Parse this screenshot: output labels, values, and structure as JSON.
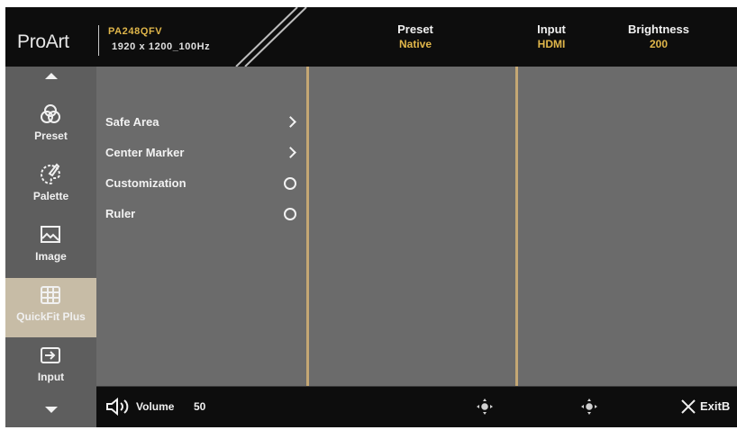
{
  "header": {
    "brand": "ProArt",
    "model": "PA248QFV",
    "resolution": "1920 x 1200_100Hz",
    "status": [
      {
        "label": "Preset",
        "value": "Native"
      },
      {
        "label": "Input",
        "value": "HDMI"
      },
      {
        "label": "Brightness",
        "value": "200"
      }
    ]
  },
  "sidebar": {
    "items": [
      {
        "label": "Preset",
        "icon": "preset-icon"
      },
      {
        "label": "Palette",
        "icon": "palette-icon"
      },
      {
        "label": "Image",
        "icon": "image-icon"
      },
      {
        "label": "QuickFit Plus",
        "icon": "grid-icon",
        "active": true
      },
      {
        "label": "Input",
        "icon": "input-icon"
      }
    ]
  },
  "menu": {
    "items": [
      {
        "label": "Safe Area",
        "control": "submenu"
      },
      {
        "label": "Center Marker",
        "control": "submenu"
      },
      {
        "label": "Customization",
        "control": "radio"
      },
      {
        "label": "Ruler",
        "control": "radio"
      }
    ]
  },
  "footer": {
    "volume_label": "Volume",
    "volume_value": "50",
    "exit_label": "ExitB"
  },
  "colors": {
    "accent_gold": "#e0b64a",
    "divider": "#c4a774",
    "active_item_bg": "#c7bca6",
    "panel_bg": "#6b6b6b",
    "bar_bg": "#0d0d0d"
  }
}
